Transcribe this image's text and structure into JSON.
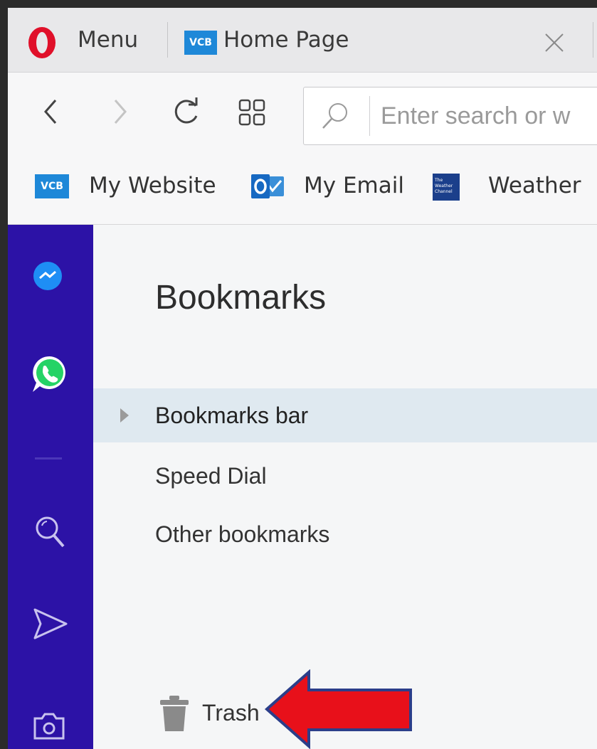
{
  "tabbar": {
    "menu_label": "Menu",
    "tab": {
      "badge": "VCB",
      "title": "Home Page"
    }
  },
  "nav": {
    "search_placeholder": "Enter search or w"
  },
  "bookmarks_bar": {
    "items": [
      {
        "label": "My Website",
        "icon": "vcb-badge",
        "badge": "VCB"
      },
      {
        "label": "My Email",
        "icon": "outlook-icon"
      },
      {
        "label": "Weather",
        "icon": "weather-channel-icon",
        "badge": "The Weather Channel"
      }
    ]
  },
  "sidebar": {
    "icons": [
      "messenger-icon",
      "whatsapp-icon",
      "search-icon",
      "send-icon",
      "camera-icon"
    ]
  },
  "bookmarks_panel": {
    "title": "Bookmarks",
    "folders": [
      {
        "label": "Bookmarks bar",
        "selected": true,
        "expandable": true
      },
      {
        "label": "Speed Dial",
        "selected": false,
        "expandable": false
      },
      {
        "label": "Other bookmarks",
        "selected": false,
        "expandable": false
      }
    ],
    "trash_label": "Trash"
  },
  "colors": {
    "sidebar": "#2c12a6",
    "selected_row": "#dfe9f0",
    "opera_red": "#e0102a",
    "vcb_blue": "#1e88d8",
    "annotation_arrow": "#e8101a"
  }
}
